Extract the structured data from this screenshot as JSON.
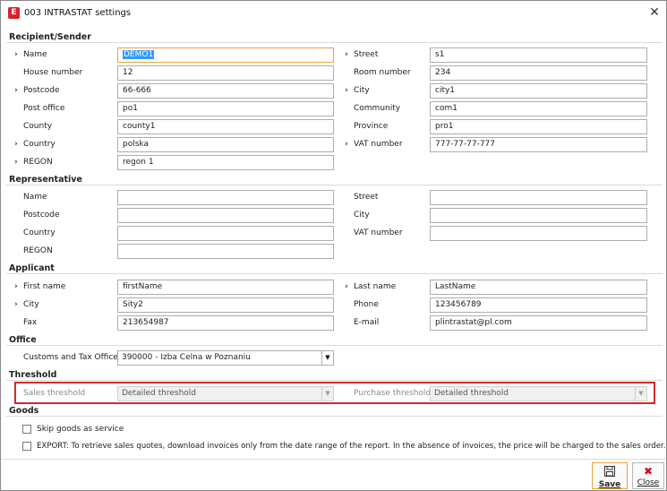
{
  "window": {
    "app_icon": "E",
    "title": "003 INTRASTAT settings",
    "close_glyph": "✕"
  },
  "sections": {
    "recipient": "Recipient/Sender",
    "representative": "Representative",
    "applicant": "Applicant",
    "office": "Office",
    "threshold": "Threshold",
    "goods": "Goods"
  },
  "recipient": {
    "name_label": "Name",
    "name_value": "DEMO1",
    "street_label": "Street",
    "street_value": "s1",
    "house_label": "House number",
    "house_value": "12",
    "room_label": "Room number",
    "room_value": "234",
    "postcode_label": "Postcode",
    "postcode_value": "66-666",
    "city_label": "City",
    "city_value": "city1",
    "postoffice_label": "Post office",
    "postoffice_value": "po1",
    "community_label": "Community",
    "community_value": "com1",
    "county_label": "County",
    "county_value": "county1",
    "province_label": "Province",
    "province_value": "pro1",
    "country_label": "Country",
    "country_value": "polska",
    "vat_label": "VAT number",
    "vat_value": "777-77-77-777",
    "regon_label": "REGON",
    "regon_value": "regon 1"
  },
  "representative": {
    "name_label": "Name",
    "name_value": "",
    "street_label": "Street",
    "street_value": "",
    "postcode_label": "Postcode",
    "postcode_value": "",
    "city_label": "City",
    "city_value": "",
    "country_label": "Country",
    "country_value": "",
    "vat_label": "VAT number",
    "vat_value": "",
    "regon_label": "REGON",
    "regon_value": ""
  },
  "applicant": {
    "firstname_label": "First name",
    "firstname_value": "firstName",
    "lastname_label": "Last name",
    "lastname_value": "LastName",
    "city_label": "City",
    "city_value": "Sity2",
    "phone_label": "Phone",
    "phone_value": "123456789",
    "fax_label": "Fax",
    "fax_value": "213654987",
    "email_label": "E-mail",
    "email_value": "plintrastat@pl.com"
  },
  "office": {
    "customs_label": "Customs and Tax Office",
    "customs_value": "390000 - Izba Celna w Poznaniu"
  },
  "threshold": {
    "sales_label": "Sales threshold",
    "sales_value": "Detailed threshold",
    "purchase_label": "Purchase threshold",
    "purchase_value": "Detailed threshold"
  },
  "goods": {
    "skip_label": "Skip goods as service",
    "export_label": "EXPORT: To retrieve sales quotes, download invoices only from the date range of the report. In the absence of invoices, the price will be charged to the sales order."
  },
  "footer": {
    "save_label": "Save",
    "close_label": "Close",
    "save_icon": "floppy-disk-icon",
    "close_icon": "red-x-icon"
  },
  "colors": {
    "brand": "#d6232c",
    "highlight": "#d62828",
    "focus": "#e8a33c",
    "selection": "#3399ff"
  }
}
